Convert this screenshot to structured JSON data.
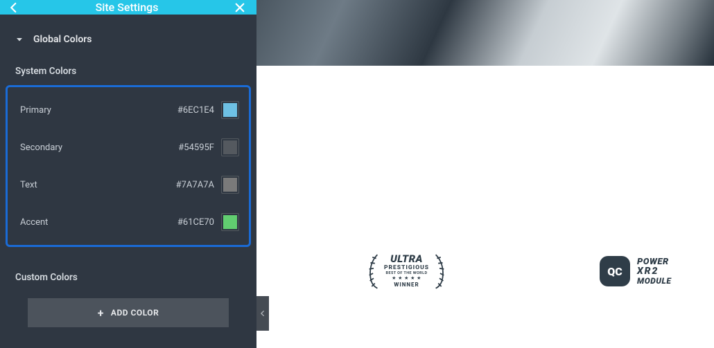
{
  "header": {
    "title": "Site Settings"
  },
  "section": {
    "title": "Global Colors"
  },
  "system": {
    "heading": "System Colors",
    "items": [
      {
        "label": "Primary",
        "hex": "#6EC1E4"
      },
      {
        "label": "Secondary",
        "hex": "#54595F"
      },
      {
        "label": "Text",
        "hex": "#7A7A7A"
      },
      {
        "label": "Accent",
        "hex": "#61CE70"
      }
    ]
  },
  "custom": {
    "heading": "Custom Colors",
    "add_label": "ADD COLOR"
  },
  "preview": {
    "award": {
      "line1": "ULTRA",
      "line2": "PRESTIGIOUS",
      "line3": "BEST OF THE WORLD",
      "stars": "★ ★ ★ ★ ★",
      "winner": "WINNER"
    },
    "brand2": {
      "badge": "QC",
      "l1": "POWER",
      "l2a": "XR2",
      "l3": "MODULE"
    }
  }
}
